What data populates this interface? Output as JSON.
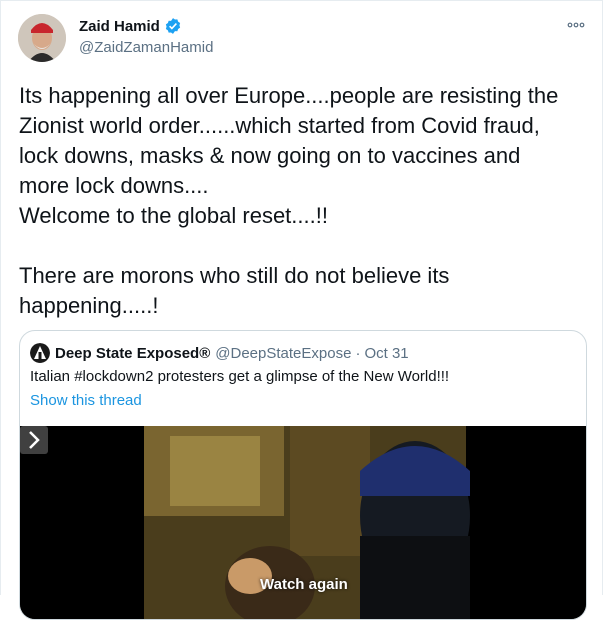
{
  "tweet": {
    "display_name": "Zaid Hamid",
    "handle": "@ZaidZamanHamid",
    "text": "Its happening all over Europe....people are resisting the\nZionist world order......which started from Covid fraud,\nlock downs, masks & now going on to vaccines and\nmore lock downs....\nWelcome to the global reset....!!\n\nThere are morons who still do not believe its\nhappening.....!",
    "icons": {
      "verified": "verified-badge-icon",
      "more": "more-options-icon"
    },
    "colors": {
      "verified": "#1da1f2",
      "handle": "#5b7083",
      "link": "#1b95e0"
    }
  },
  "quoted_tweet": {
    "display_name": "Deep State Exposed®",
    "handle": "@DeepStateExpose",
    "separator": "·",
    "date": "Oct 31",
    "text": "Italian #lockdown2 protesters get a glimpse of the New World!!!",
    "show_thread_label": "Show this thread",
    "video": {
      "overlay_label": "Watch again",
      "next_icon": "next-arrow-icon"
    }
  }
}
